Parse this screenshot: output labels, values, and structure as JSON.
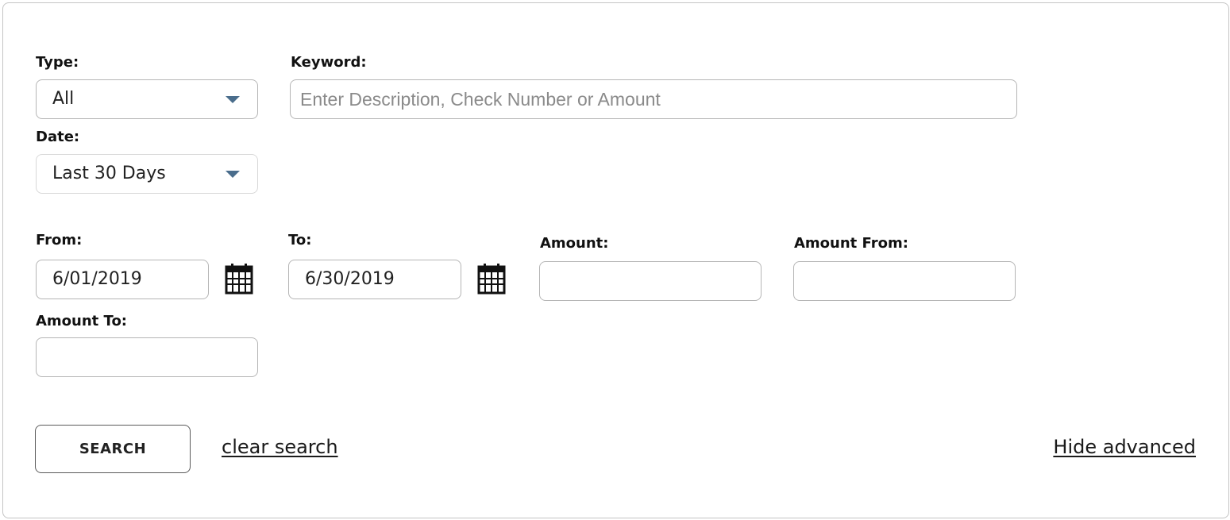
{
  "filters": {
    "type": {
      "label": "Type:",
      "value": "All"
    },
    "keyword": {
      "label": "Keyword:",
      "placeholder": "Enter Description, Check Number or Amount"
    },
    "date": {
      "label": "Date:",
      "value": "Last 30 Days"
    },
    "from": {
      "label": "From:",
      "value": "6/01/2019"
    },
    "to": {
      "label": "To:",
      "value": "6/30/2019"
    },
    "amount": {
      "label": "Amount:",
      "value": ""
    },
    "amount_from": {
      "label": "Amount From:",
      "value": ""
    },
    "amount_to": {
      "label": "Amount To:",
      "value": ""
    }
  },
  "actions": {
    "search_label": "SEARCH",
    "clear_label": "clear search",
    "hide_advanced_label": "Hide advanced"
  },
  "icons": {
    "dropdown": "chevron-down-icon",
    "calendar": "calendar-icon"
  },
  "colors": {
    "caret": "#4a6d8c",
    "border": "#b5b5b5",
    "text": "#1a1a1a"
  }
}
